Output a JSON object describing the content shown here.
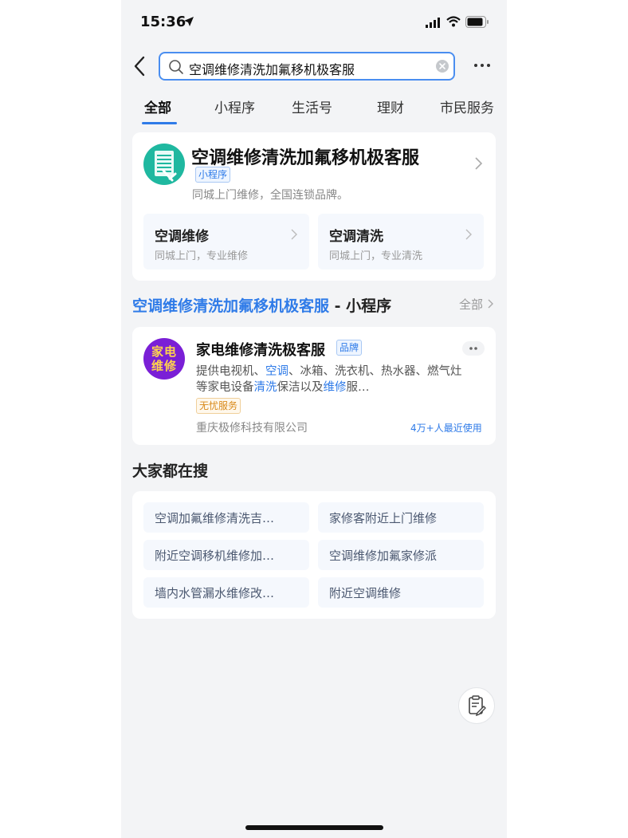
{
  "status_bar": {
    "time": "15:36"
  },
  "search": {
    "query": "空调维修清洗加氟移机极客服"
  },
  "tabs": [
    "全部",
    "小程序",
    "生活号",
    "理财",
    "市民服务"
  ],
  "top_result": {
    "title": "空调维修清洗加氟移机极客服",
    "tag": "小程序",
    "description": "同城上门维修，全国连锁品牌。",
    "services": [
      {
        "title": "空调维修",
        "desc": "同城上门，专业维修"
      },
      {
        "title": "空调清洗",
        "desc": "同城上门，专业清洗"
      }
    ]
  },
  "miniapp_section": {
    "title_highlight": "空调维修清洗加氟移机极客服",
    "title_suffix": " - 小程序",
    "more_label": "全部"
  },
  "miniapp_result": {
    "logo_text": "家电维修",
    "name": "家电维修清洗极客服",
    "tag": "品牌",
    "desc_line1_a": "提供电视机、",
    "desc_line1_hl": "空调",
    "desc_line1_b": "、冰箱、洗衣机、热水器、燃气灶",
    "desc_line2_a": "等家电设备",
    "desc_line2_hl1": "清洗",
    "desc_line2_b": "保洁以及",
    "desc_line2_hl2": "维修",
    "desc_line2_c": "服…",
    "service_tag": "无忧服务",
    "company": "重庆极修科技有限公司",
    "usage": "4万+人最近使用"
  },
  "popular": {
    "title": "大家都在搜",
    "items": [
      "空调加氟维修清洗吉…",
      "家修客附近上门维修",
      "附近空调移机维修加…",
      "空调维修加氟家修派",
      "墙内水管漏水维修改…",
      "附近空调维修"
    ]
  },
  "colors": {
    "accent": "#2f7be8",
    "background": "#f3f4f6",
    "logo_purple": "#7a1fd6",
    "service_tag": "#d98a1a"
  }
}
